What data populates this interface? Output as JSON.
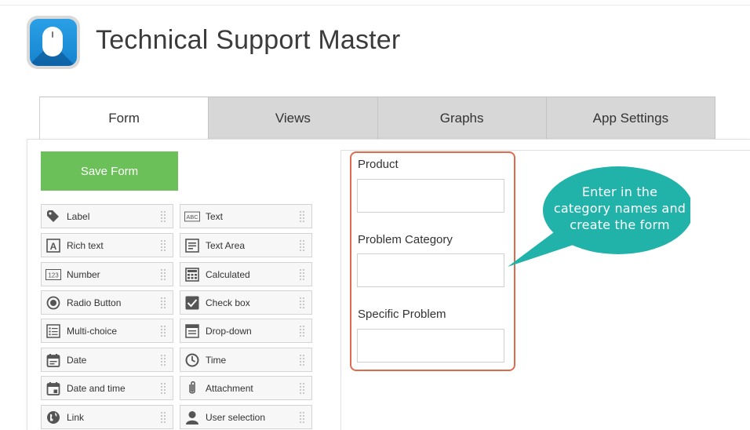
{
  "app": {
    "title": "Technical Support Master"
  },
  "tabs": [
    {
      "label": "Form",
      "active": true
    },
    {
      "label": "Views",
      "active": false
    },
    {
      "label": "Graphs",
      "active": false
    },
    {
      "label": "App Settings",
      "active": false
    }
  ],
  "toolbar": {
    "save_label": "Save Form"
  },
  "palette": {
    "left": [
      {
        "label": "Label",
        "icon": "tag-icon"
      },
      {
        "label": "Rich text",
        "icon": "rich-text-icon"
      },
      {
        "label": "Number",
        "icon": "number-icon"
      },
      {
        "label": "Radio Button",
        "icon": "radio-icon"
      },
      {
        "label": "Multi-choice",
        "icon": "list-icon"
      },
      {
        "label": "Date",
        "icon": "calendar-icon"
      },
      {
        "label": "Date and time",
        "icon": "calendar-clock-icon"
      },
      {
        "label": "Link",
        "icon": "globe-icon"
      }
    ],
    "right": [
      {
        "label": "Text",
        "icon": "abc-icon"
      },
      {
        "label": "Text Area",
        "icon": "text-area-icon"
      },
      {
        "label": "Calculated",
        "icon": "calculator-icon"
      },
      {
        "label": "Check box",
        "icon": "checkbox-icon"
      },
      {
        "label": "Drop-down",
        "icon": "dropdown-icon"
      },
      {
        "label": "Time",
        "icon": "clock-icon"
      },
      {
        "label": "Attachment",
        "icon": "paperclip-icon"
      },
      {
        "label": "User selection",
        "icon": "user-icon"
      }
    ]
  },
  "form": {
    "fields": [
      {
        "label": "Product",
        "value": ""
      },
      {
        "label": "Problem Category",
        "value": ""
      },
      {
        "label": "Specific Problem",
        "value": ""
      }
    ]
  },
  "callout": {
    "text": "Enter in the category names and create the form",
    "line1": "Enter in the",
    "line2": "category names and",
    "line3": "create the form",
    "color": "#21b2aa"
  },
  "colors": {
    "save_button": "#6cc05a",
    "highlight_border": "#e06a4e",
    "app_icon": "#1e8fd8"
  }
}
